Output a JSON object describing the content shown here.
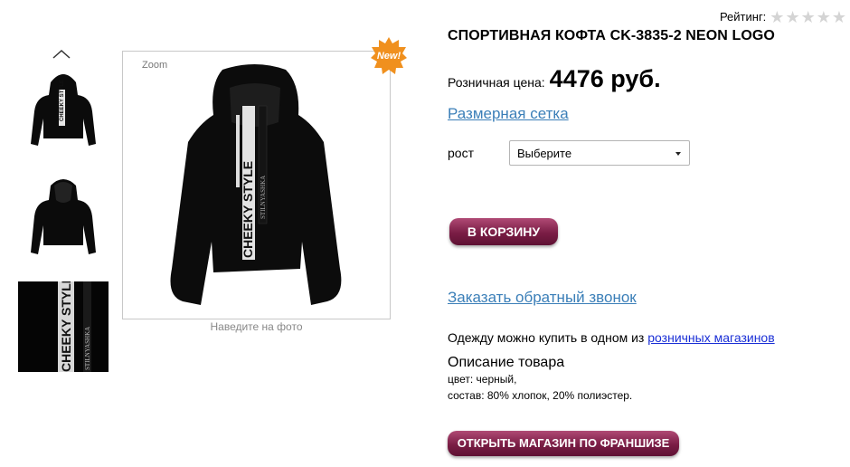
{
  "rating": {
    "label": "Рейтинг:",
    "stars": 5,
    "filled": 0,
    "star_glyph": "★",
    "star_color": "#d4d4d4"
  },
  "product": {
    "title": "СПОРТИВНАЯ КОФТА CK-3835-2 NEON LOGO",
    "price_label": "Розничная цена:",
    "price_value": "4476 руб.",
    "size_chart_link": "Размерная сетка",
    "height_label": "рост",
    "height_select": {
      "value": "Выберите"
    },
    "cart_button": "В КОРЗИНУ",
    "callback_link": "Заказать обратный звонок",
    "stores_text": "Одежду можно купить в одном из",
    "stores_link": "розничных магазинов",
    "description_heading": "Описание товара",
    "description_color": "цвет: черный,",
    "description_composition": "состав: 80% хлопок, 20% полиэстер.",
    "franchise_button": "ОТКРЫТЬ МАГАЗИН ПО ФРАНШИЗЕ"
  },
  "gallery": {
    "zoom_label": "Zoom",
    "new_badge": "New!",
    "hover_hint": "Наведите на фото",
    "thumbnails": [
      "hoodie-front",
      "hoodie-back",
      "hoodie-detail"
    ],
    "print_text": "CHEEKY STYLE",
    "string_text": "STILNYASHKA"
  },
  "colors": {
    "accent_button": "#7a1d45",
    "link": "#3b7fb8",
    "badge": "#f0901e"
  }
}
